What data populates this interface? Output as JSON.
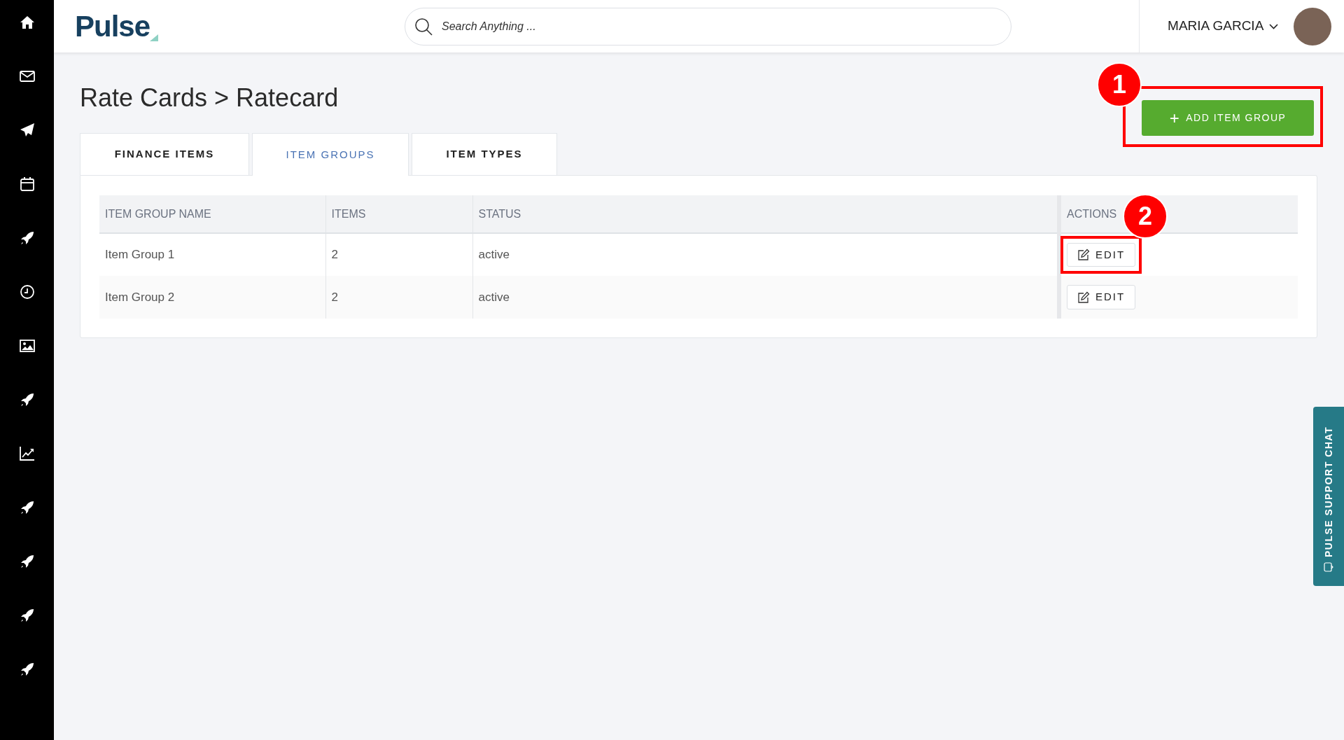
{
  "header": {
    "logo": "Pulse",
    "search": {
      "placeholder": "Search Anything ..."
    },
    "user": {
      "name": "MARIA GARCIA"
    }
  },
  "page": {
    "breadcrumb": "Rate Cards > Ratecard",
    "add_button": {
      "label": "ADD ITEM GROUP",
      "icon": "+",
      "callout": "1"
    }
  },
  "tabs": [
    {
      "label": "FINANCE ITEMS",
      "selected": false
    },
    {
      "label": "ITEM GROUPS",
      "selected": true
    },
    {
      "label": "ITEM TYPES",
      "selected": false
    }
  ],
  "table": {
    "columns": [
      "ITEM GROUP NAME",
      "ITEMS",
      "STATUS",
      "ACTIONS"
    ],
    "rows": [
      {
        "cells": [
          "Item Group 1",
          "2",
          "active"
        ],
        "action": "EDIT",
        "callout": "2"
      },
      {
        "cells": [
          "Item Group 2",
          "2",
          "active"
        ],
        "action": "EDIT"
      }
    ]
  },
  "support_chat": {
    "label": "PULSE SUPPORT CHAT"
  }
}
